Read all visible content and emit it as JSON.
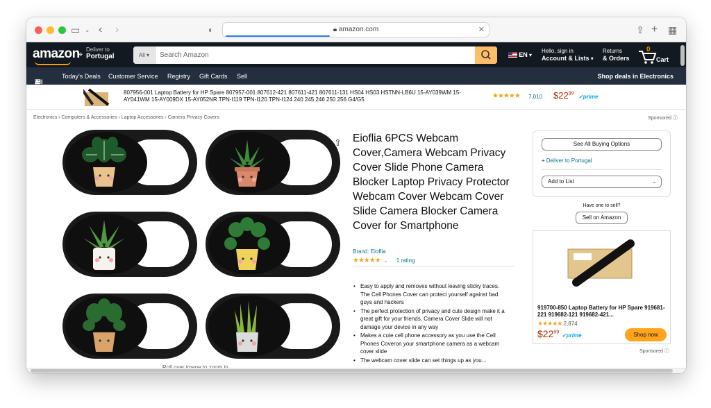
{
  "browser": {
    "url": "amazon.com"
  },
  "nav": {
    "logo": "amazon",
    "deliver_label": "Deliver to",
    "deliver_location": "Portugal",
    "search_category": "All",
    "search_placeholder": "Search Amazon",
    "language": "EN",
    "account_line1": "Hello, sign in",
    "account_line2": "Account & Lists",
    "returns_line1": "Returns",
    "returns_line2": "& Orders",
    "cart_count": "0",
    "cart_label": "Cart"
  },
  "subnav": {
    "all": "All",
    "items": [
      "Today's Deals",
      "Customer Service",
      "Registry",
      "Gift Cards",
      "Sell"
    ],
    "right": "Shop deals in Electronics"
  },
  "promo": {
    "title": "807956-001 Laptop Battery for HP Spare 807957-001 807612-421 807611-421 807611-131 HS04 HS03 HSTNN-LB6U 15-AY039WM 15-AY041WM 15-AY009DX 15-AY052NR TPN-I119 TPN-I120 TPN-I124 240 245 246 250 256 G4/G5",
    "stars": "★★★★★",
    "reviews": "7,010",
    "price_whole": "$22",
    "price_cents": "99",
    "prime": "✓prime"
  },
  "breadcrumb": "Electronics › Computers & Accessories › Laptop Accessories › Camera Privacy Covers",
  "sponsored": "Sponsored",
  "product": {
    "title": "Eioflia 6PCS Webcam Cover,Camera Webcam Privacy Cover Slide Phone Camera Blocker Laptop Privacy Protector Webcam Cover Webcam Cover Slide Camera Blocker Camera Cover for Smartphone",
    "brand": "Brand: Eioflia",
    "stars": "★★★★★",
    "rating_count": "1 rating",
    "zoom_hint": "Roll over image to zoom in",
    "bullets": [
      "Easy to apply and removes without leaving sticky traces. The Cell Phones Cover can protect yourself against bad guys and hackers",
      "The perfect protection of privacy and cute design make it a great gift for your friends. Camera Cover Slide will not damage your device in any way",
      "Makes a cute cell phone accessory as you use the Cell Phones Coveron your smartphone camera as a webcam cover slide",
      "The webcam cover slide can set things up as you..."
    ]
  },
  "buybox": {
    "see_all": "See All Buying Options",
    "deliver": "Deliver to Portugal",
    "add_list": "Add to List",
    "have_one": "Have one to sell?",
    "sell": "Sell on Amazon"
  },
  "ad": {
    "title": "919700-850 Laptop Battery for HP Spare 919681-221 919682-121 919682-421...",
    "stars": "★★★★★",
    "reviews": "2,874",
    "price_whole": "$22",
    "price_cents": "99",
    "prime": "✓prime",
    "button": "Shop now",
    "sponsored": "Sponsored"
  },
  "colors": {
    "nav_bg": "#131921",
    "subnav_bg": "#232f3e",
    "search_btn": "#febd69",
    "price": "#b12704",
    "link": "#007185",
    "star": "#f0a41b",
    "shop_now": "#ffa41c"
  }
}
